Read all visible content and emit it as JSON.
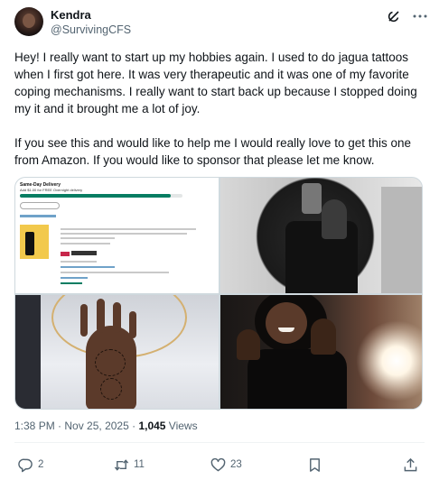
{
  "author": {
    "display_name": "Kendra",
    "handle": "@SurvivingCFS"
  },
  "tweet": {
    "paragraph_1": "Hey! I really want to start up my hobbies again. I used to do jagua tattoos when I first got here. It was very therapeutic and it was one of my favorite coping mechanisms. I really want to start back up because I stopped doing my it and it brought me a lot of joy.",
    "paragraph_2": "If you see this and would like to help me I would really love to get this one from Amazon. If you would like to sponsor that please let me know."
  },
  "media": {
    "amazon": {
      "title": "Same-Day Delivery",
      "subtitle": "Add $1.00 for FREE Overnight delivery",
      "progress": 0.93
    }
  },
  "meta": {
    "time": "1:38 PM",
    "separator": " · ",
    "date": "Nov 25, 2025",
    "views_count": "1,045",
    "views_label": " Views"
  },
  "actions": {
    "replies": "2",
    "reposts": "11",
    "likes": "23"
  },
  "icons": [
    "grok-icon",
    "more-icon",
    "reply-icon",
    "repost-icon",
    "like-icon",
    "bookmark-icon",
    "share-icon"
  ]
}
